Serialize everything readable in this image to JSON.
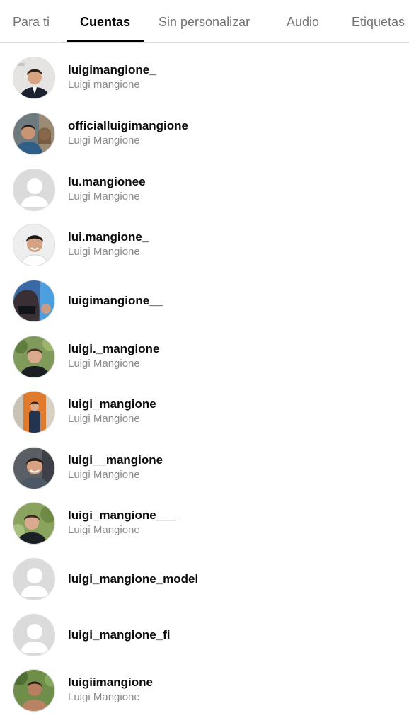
{
  "tabs": [
    {
      "label": "Para ti",
      "active": false
    },
    {
      "label": "Cuentas",
      "active": true
    },
    {
      "label": "Sin personalizar",
      "active": false
    },
    {
      "label": "Audio",
      "active": false
    },
    {
      "label": "Etiquetas",
      "active": false
    }
  ],
  "accounts": [
    {
      "username": "luigimangione_",
      "full_name": "Luigi mangione",
      "avatar": "photo-suit-man"
    },
    {
      "username": "officialluigimangione",
      "full_name": "Luigi Mangione",
      "avatar": "photo-selfie"
    },
    {
      "username": "lu.mangionee",
      "full_name": "Luigi Mangione",
      "avatar": "default-avatar"
    },
    {
      "username": "lui.mangione_",
      "full_name": "Luigi Mangione",
      "avatar": "photo-man-smiling"
    },
    {
      "username": "luigimangione__",
      "full_name": "",
      "avatar": "photo-masked"
    },
    {
      "username": "luigi._mangione",
      "full_name": "Luigi Mangione",
      "avatar": "photo-man-trees"
    },
    {
      "username": "luigi_mangione",
      "full_name": "Luigi Mangione",
      "avatar": "photo-man-orange-wall"
    },
    {
      "username": "luigi__mangione",
      "full_name": "Luigi Mangione",
      "avatar": "photo-man-smiling"
    },
    {
      "username": "luigi_mangione___",
      "full_name": "Luigi Mangione",
      "avatar": "photo-man-trees"
    },
    {
      "username": "luigi_mangione_model",
      "full_name": "",
      "avatar": "default-avatar"
    },
    {
      "username": "luigi_mangione_fi",
      "full_name": "",
      "avatar": "default-avatar"
    },
    {
      "username": "luigiimangione",
      "full_name": "Luigi Mangione",
      "avatar": "photo-shirtless-outdoors"
    }
  ],
  "colors": {
    "text_primary": "#0a0a0a",
    "text_secondary": "#8a8a8a",
    "tab_inactive": "#737373",
    "divider": "#dbdbdb",
    "default_avatar_bg": "#dbdbdb"
  }
}
